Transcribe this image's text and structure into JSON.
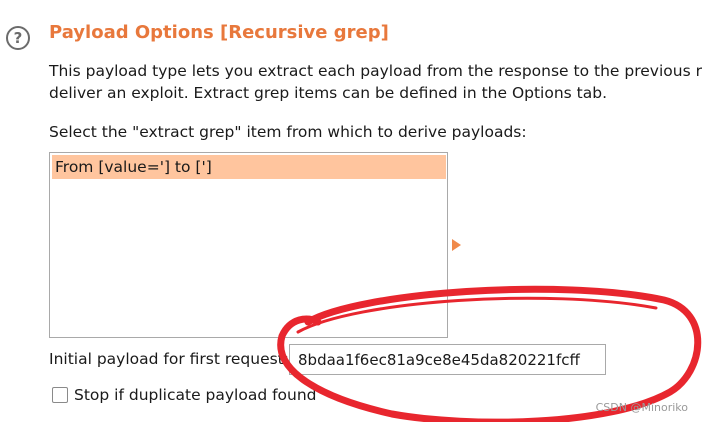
{
  "panel": {
    "help_icon_glyph": "?",
    "title": "Payload Options [Recursive grep]",
    "description_lines": [
      "This payload type lets you extract each payload from the response to the previous req",
      "deliver an exploit. Extract grep items can be defined in the Options tab."
    ],
    "select_label": "Select the \"extract grep\" item from which to derive payloads:",
    "list_items": [
      {
        "label": "From [value='] to [']",
        "selected": true
      }
    ],
    "initial_payload_label": "Initial payload for first request:",
    "initial_payload_value": "8bdaa1f6ec81a9ce8e45da820221fcff",
    "stop_duplicate_label": "Stop if duplicate payload found",
    "stop_duplicate_checked": false
  },
  "watermark": "CSDN @Minoriko",
  "colors": {
    "title": "#e8783c",
    "selection": "#ffc59e",
    "annotation_red": "#e8262e",
    "arrow": "#f08a4b"
  }
}
